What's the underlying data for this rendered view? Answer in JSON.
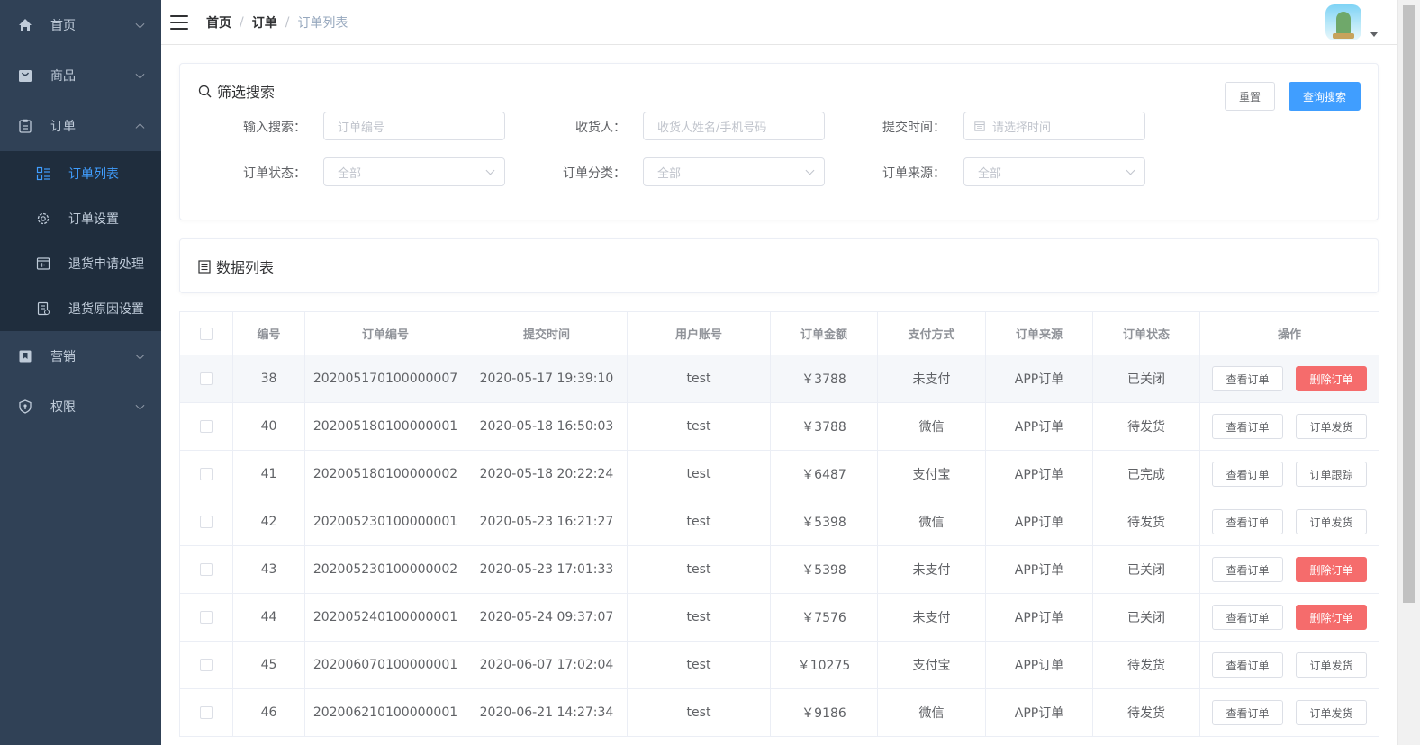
{
  "sidebar": {
    "items": [
      {
        "label": "首页",
        "icon": "home-icon"
      },
      {
        "label": "商品",
        "icon": "shopping-bag-icon"
      },
      {
        "label": "订单",
        "icon": "clipboard-icon"
      },
      {
        "label": "营销",
        "icon": "bookmark-icon"
      },
      {
        "label": "权限",
        "icon": "shield-icon"
      }
    ],
    "order_submenu": [
      {
        "label": "订单列表",
        "icon": "list-icon",
        "active": true
      },
      {
        "label": "订单设置",
        "icon": "gear-icon"
      },
      {
        "label": "退货申请处理",
        "icon": "return-icon"
      },
      {
        "label": "退货原因设置",
        "icon": "document-icon"
      }
    ],
    "active_color": "#409eff",
    "bg_color": "#304156"
  },
  "header": {
    "breadcrumb": [
      "首页",
      "订单",
      "订单列表"
    ]
  },
  "filter": {
    "title": "筛选搜索",
    "reset_label": "重置",
    "search_label": "查询搜索",
    "fields": {
      "keyword_label": "输入搜索：",
      "keyword_placeholder": "订单编号",
      "receiver_label": "收货人：",
      "receiver_placeholder": "收货人姓名/手机号码",
      "time_label": "提交时间：",
      "time_placeholder": "请选择时间",
      "status_label": "订单状态：",
      "status_value": "全部",
      "category_label": "订单分类：",
      "category_value": "全部",
      "source_label": "订单来源：",
      "source_value": "全部"
    }
  },
  "data_list": {
    "title": "数据列表"
  },
  "table": {
    "columns": [
      "编号",
      "订单编号",
      "提交时间",
      "用户账号",
      "订单金额",
      "支付方式",
      "订单来源",
      "订单状态",
      "操作"
    ],
    "rows": [
      {
        "id": "38",
        "order_no": "202005170100000007",
        "time": "2020-05-17 19:39:10",
        "user": "test",
        "amount": "￥3788",
        "pay": "未支付",
        "source": "APP订单",
        "status": "已关闭",
        "op1": "查看订单",
        "op2": "删除订单",
        "op2_type": "danger"
      },
      {
        "id": "40",
        "order_no": "202005180100000001",
        "time": "2020-05-18 16:50:03",
        "user": "test",
        "amount": "￥3788",
        "pay": "微信",
        "source": "APP订单",
        "status": "待发货",
        "op1": "查看订单",
        "op2": "订单发货",
        "op2_type": "default"
      },
      {
        "id": "41",
        "order_no": "202005180100000002",
        "time": "2020-05-18 20:22:24",
        "user": "test",
        "amount": "￥6487",
        "pay": "支付宝",
        "source": "APP订单",
        "status": "已完成",
        "op1": "查看订单",
        "op2": "订单跟踪",
        "op2_type": "default"
      },
      {
        "id": "42",
        "order_no": "202005230100000001",
        "time": "2020-05-23 16:21:27",
        "user": "test",
        "amount": "￥5398",
        "pay": "微信",
        "source": "APP订单",
        "status": "待发货",
        "op1": "查看订单",
        "op2": "订单发货",
        "op2_type": "default"
      },
      {
        "id": "43",
        "order_no": "202005230100000002",
        "time": "2020-05-23 17:01:33",
        "user": "test",
        "amount": "￥5398",
        "pay": "未支付",
        "source": "APP订单",
        "status": "已关闭",
        "op1": "查看订单",
        "op2": "删除订单",
        "op2_type": "danger"
      },
      {
        "id": "44",
        "order_no": "202005240100000001",
        "time": "2020-05-24 09:37:07",
        "user": "test",
        "amount": "￥7576",
        "pay": "未支付",
        "source": "APP订单",
        "status": "已关闭",
        "op1": "查看订单",
        "op2": "删除订单",
        "op2_type": "danger"
      },
      {
        "id": "45",
        "order_no": "202006070100000001",
        "time": "2020-06-07 17:02:04",
        "user": "test",
        "amount": "￥10275",
        "pay": "支付宝",
        "source": "APP订单",
        "status": "待发货",
        "op1": "查看订单",
        "op2": "订单发货",
        "op2_type": "default"
      },
      {
        "id": "46",
        "order_no": "202006210100000001",
        "time": "2020-06-21 14:27:34",
        "user": "test",
        "amount": "￥9186",
        "pay": "微信",
        "source": "APP订单",
        "status": "待发货",
        "op1": "查看订单",
        "op2": "订单发货",
        "op2_type": "default"
      }
    ]
  }
}
